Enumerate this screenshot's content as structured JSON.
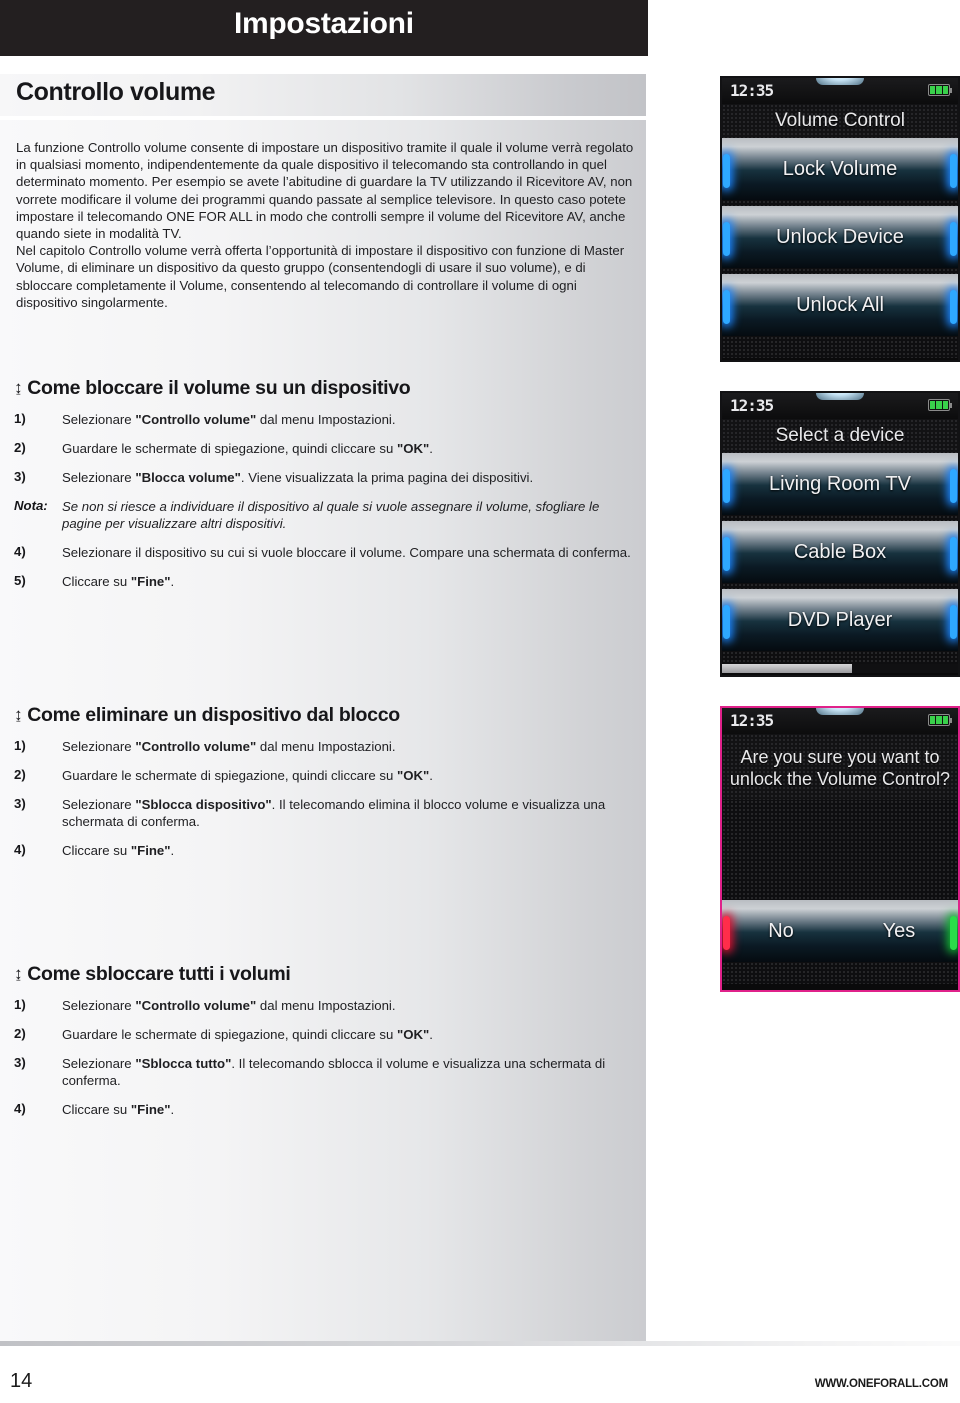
{
  "header": {
    "title": "Impostazioni"
  },
  "page_title": "Controllo volume",
  "intro": "La funzione Controllo volume consente di impostare un dispositivo tramite il quale il volume verrà regolato in qualsiasi momento, indipendentemente da quale dispositivo il telecomando sta controllando in quel determinato momento. Per esempio se avete l’abitudine di guardare la TV utilizzando il Ricevitore AV, non vorrete modificare il volume dei programmi quando passate al semplice televisore. In questo caso potete impostare il telecomando ONE FOR ALL in modo che controlli sempre il volume del Ricevitore AV, anche quando siete in modalità TV.",
  "intro2": "Nel capitolo Controllo volume verrà offerta l’opportunità di impostare il dispositivo con funzione di Master Volume, di eliminare un dispositivo da questo gruppo (consentendogli di usare il suo volume), e di sbloccare completamente il Volume, consentendo al telecomando di controllare il volume di ogni dispositivo singolarmente.",
  "sections": [
    {
      "arrow": "↨",
      "heading": "Come bloccare il volume su un dispositivo",
      "steps": [
        {
          "marker": "1)",
          "html": "Selezionare <b>\"Controllo volume\"</b> dal menu Impostazioni."
        },
        {
          "marker": "2)",
          "html": "Guardare le schermate di spiegazione, quindi cliccare su <b>\"OK\"</b>."
        },
        {
          "marker": "3)",
          "html": "Selezionare <b>\"Blocca volume\"</b>. Viene visualizzata la prima pagina dei dispositivi."
        },
        {
          "marker": "Nota:",
          "note": true,
          "html": "Se non si riesce a individuare il dispositivo al quale si vuole assegnare il volume, sfogliare le pagine per visualizzare altri dispositivi."
        },
        {
          "marker": "4)",
          "html": "Selezionare il dispositivo su cui si vuole bloccare il volume. Compare una schermata di conferma."
        },
        {
          "marker": "5)",
          "html": "Cliccare su <b>\"Fine\"</b>."
        }
      ]
    },
    {
      "arrow": "↨",
      "heading": "Come eliminare un dispositivo dal blocco",
      "steps": [
        {
          "marker": "1)",
          "html": "Selezionare <b>\"Controllo volume\"</b> dal menu Impostazioni."
        },
        {
          "marker": "2)",
          "html": "Guardare le schermate di spiegazione, quindi cliccare su <b>\"OK\"</b>."
        },
        {
          "marker": "3)",
          "html": "Selezionare <b>\"Sblocca dispositivo\"</b>. Il telecomando elimina il blocco volume e visualizza una schermata di conferma."
        },
        {
          "marker": "4)",
          "html": "Cliccare su <b>\"Fine\"</b>."
        }
      ]
    },
    {
      "arrow": "↨",
      "heading": "Come sbloccare tutti i volumi",
      "steps": [
        {
          "marker": "1)",
          "html": "Selezionare <b>\"Controllo volume\"</b> dal menu Impostazioni."
        },
        {
          "marker": "2)",
          "html": "Guardare le schermate di spiegazione, quindi cliccare su <b>\"OK\"</b>."
        },
        {
          "marker": "3)",
          "html": "Selezionare <b>\"Sblocca tutto\"</b>. Il telecomando sblocca il volume e visualizza una schermata di conferma."
        },
        {
          "marker": "4)",
          "html": "Cliccare su <b>\"Fine\"</b>."
        }
      ]
    }
  ],
  "remotes": [
    {
      "clock": "12:35",
      "battery_icon": "battery-full-icon",
      "screen_title": "Volume Control",
      "buttons": [
        "Lock Volume",
        "Unlock Device",
        "Unlock All"
      ],
      "pagebar_percent": 0
    },
    {
      "clock": "12:35",
      "battery_icon": "battery-full-icon",
      "screen_title": "Select a device",
      "buttons": [
        "Living Room TV",
        "Cable Box",
        "DVD Player"
      ],
      "pagebar_percent": 55
    },
    {
      "clock": "12:35",
      "battery_icon": "battery-full-icon",
      "screen_title": "Are you sure you want to unlock the Volume Control?",
      "answers": [
        "No",
        "Yes"
      ],
      "accent_border": "#e0218a",
      "no_accent": "#ff2d4a",
      "yes_accent": "#2bdc4a"
    }
  ],
  "footer": {
    "page_number": "14",
    "url": "WWW.ONEFORALL.COM"
  }
}
